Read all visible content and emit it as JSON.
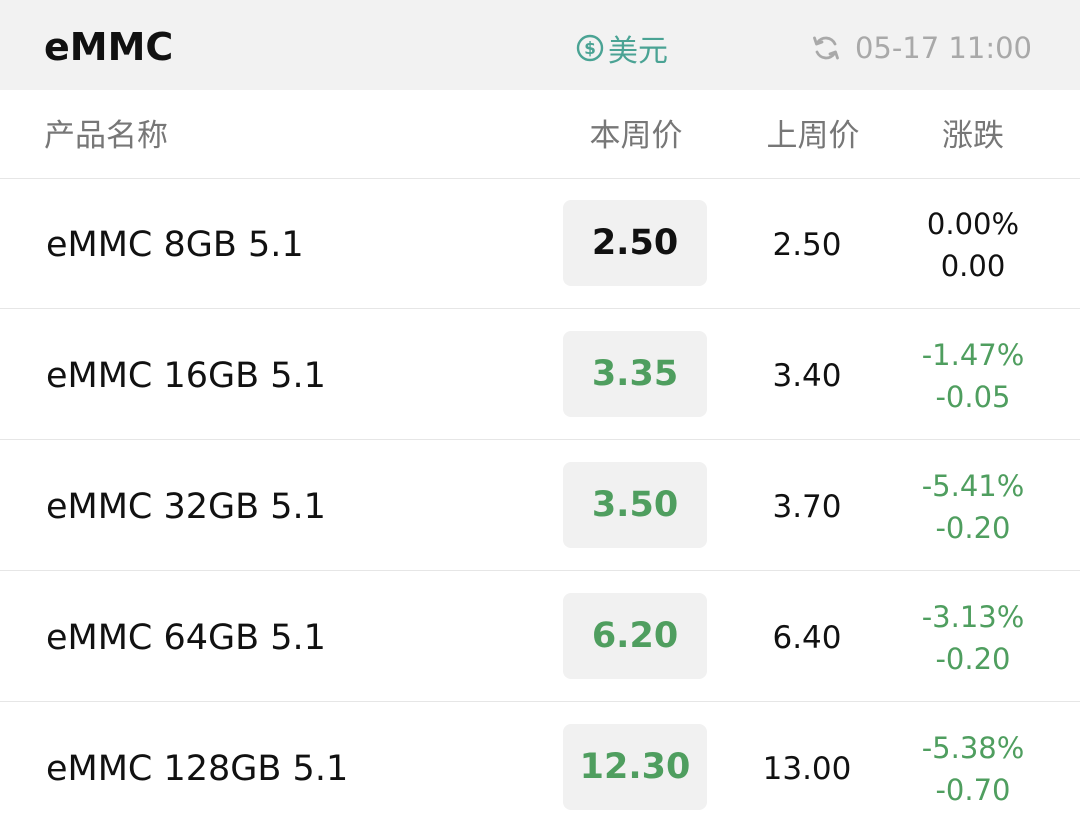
{
  "header": {
    "title": "eMMC",
    "currency_label": "美元",
    "timestamp": "05-17 11:00"
  },
  "columns": {
    "name": "产品名称",
    "this_week": "本周价",
    "last_week": "上周价",
    "change": "涨跌"
  },
  "colors": {
    "accent_teal": "#4aa394",
    "down_green": "#4f9e5f",
    "flat": "#111111",
    "topbar_bg": "#f2f2f2"
  },
  "rows": [
    {
      "name": "eMMC 8GB 5.1",
      "this_week": "2.50",
      "last_week": "2.50",
      "change_pct": "0.00%",
      "change_abs": "0.00",
      "trend": "flat"
    },
    {
      "name": "eMMC 16GB 5.1",
      "this_week": "3.35",
      "last_week": "3.40",
      "change_pct": "-1.47%",
      "change_abs": "-0.05",
      "trend": "down"
    },
    {
      "name": "eMMC 32GB 5.1",
      "this_week": "3.50",
      "last_week": "3.70",
      "change_pct": "-5.41%",
      "change_abs": "-0.20",
      "trend": "down"
    },
    {
      "name": "eMMC 64GB 5.1",
      "this_week": "6.20",
      "last_week": "6.40",
      "change_pct": "-3.13%",
      "change_abs": "-0.20",
      "trend": "down"
    },
    {
      "name": "eMMC 128GB 5.1",
      "this_week": "12.30",
      "last_week": "13.00",
      "change_pct": "-5.38%",
      "change_abs": "-0.70",
      "trend": "down"
    }
  ]
}
